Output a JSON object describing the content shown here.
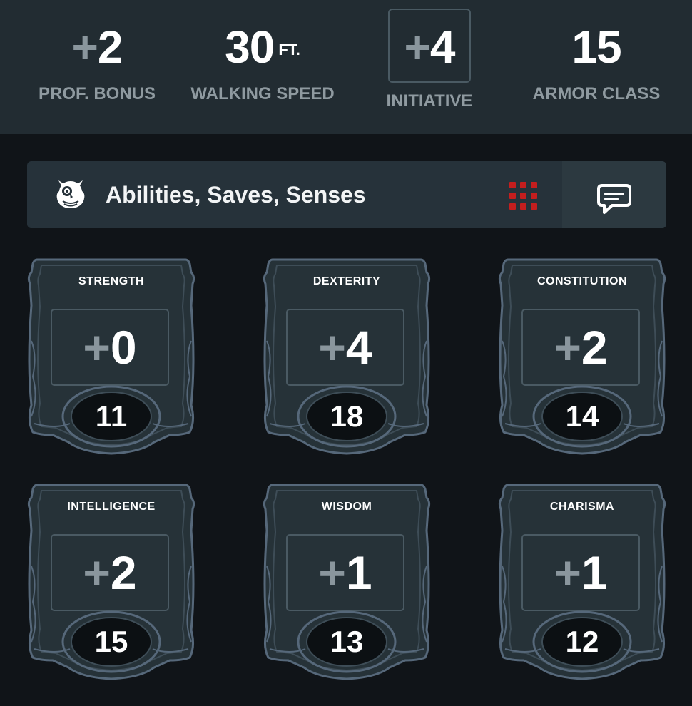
{
  "stats": {
    "prof_bonus": {
      "sign": "+",
      "value": "2",
      "label": "PROF. BONUS"
    },
    "walking_speed": {
      "value": "30",
      "unit": "FT.",
      "label": "WALKING SPEED"
    },
    "initiative": {
      "sign": "+",
      "value": "4",
      "label": "INITIATIVE"
    },
    "armor_class": {
      "value": "15",
      "label": "ARMOR CLASS"
    }
  },
  "section": {
    "title": "Abilities, Saves, Senses",
    "icons": {
      "left": "owl-icon",
      "grid": "grid-icon",
      "right": "chat-icon"
    }
  },
  "abilities": [
    {
      "name": "STRENGTH",
      "sign": "+",
      "mod": "0",
      "score": "11"
    },
    {
      "name": "DEXTERITY",
      "sign": "+",
      "mod": "4",
      "score": "18"
    },
    {
      "name": "CONSTITUTION",
      "sign": "+",
      "mod": "2",
      "score": "14"
    },
    {
      "name": "INTELLIGENCE",
      "sign": "+",
      "mod": "2",
      "score": "15"
    },
    {
      "name": "WISDOM",
      "sign": "+",
      "mod": "1",
      "score": "13"
    },
    {
      "name": "CHARISMA",
      "sign": "+",
      "mod": "1",
      "score": "12"
    }
  ],
  "colors": {
    "background": "#101418",
    "stats_bar": "#222c32",
    "header": "#26323a",
    "card_fill": "#263238",
    "card_border": "#56687a",
    "muted_text": "#8f9aa0",
    "grid_icon_red": "#c41e1e"
  }
}
